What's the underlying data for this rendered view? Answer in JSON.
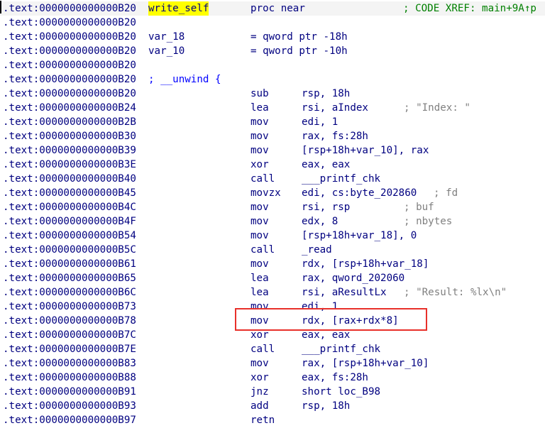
{
  "colors": {
    "address": "#000080",
    "comment": "#808080",
    "xref": "#008000",
    "highlight_name": "#ffff00",
    "annotation_box": "#e8302a"
  },
  "header": {
    "address": ".text:0000000000000B20",
    "name": "write_self",
    "proc": "proc near",
    "xref": "; CODE XREF: main+9A↑p"
  },
  "rows": [
    {
      "addr": ".text:0000000000000B20"
    },
    {
      "addr": ".text:0000000000000B20",
      "name": "var_18",
      "def": "= qword ptr -18h"
    },
    {
      "addr": ".text:0000000000000B20",
      "name": "var_10",
      "def": "= qword ptr -10h"
    },
    {
      "addr": ".text:0000000000000B20"
    },
    {
      "addr": ".text:0000000000000B20",
      "unwind": "; __unwind {"
    },
    {
      "addr": ".text:0000000000000B20",
      "mn": "sub",
      "op": "rsp, 18h"
    },
    {
      "addr": ".text:0000000000000B24",
      "mn": "lea",
      "op": "rsi, aIndex",
      "cm": "; \"Index: \"",
      "cmx": 569
    },
    {
      "addr": ".text:0000000000000B2B",
      "mn": "mov",
      "op": "edi, 1"
    },
    {
      "addr": ".text:0000000000000B30",
      "mn": "mov",
      "op": "rax, fs:28h"
    },
    {
      "addr": ".text:0000000000000B39",
      "mn": "mov",
      "op": "[rsp+18h+var_10], rax"
    },
    {
      "addr": ".text:0000000000000B3E",
      "mn": "xor",
      "op": "eax, eax"
    },
    {
      "addr": ".text:0000000000000B40",
      "mn": "call",
      "op": "___printf_chk"
    },
    {
      "addr": ".text:0000000000000B45",
      "mn": "movzx",
      "op": "edi, cs:byte_202860",
      "cm": "; fd",
      "cmx": 611
    },
    {
      "addr": ".text:0000000000000B4C",
      "mn": "mov",
      "op": "rsi, rsp",
      "cm": "; buf",
      "cmx": 569
    },
    {
      "addr": ".text:0000000000000B4F",
      "mn": "mov",
      "op": "edx, 8",
      "cm": "; nbytes",
      "cmx": 569
    },
    {
      "addr": ".text:0000000000000B54",
      "mn": "mov",
      "op": "[rsp+18h+var_18], 0"
    },
    {
      "addr": ".text:0000000000000B5C",
      "mn": "call",
      "op": "_read"
    },
    {
      "addr": ".text:0000000000000B61",
      "mn": "mov",
      "op": "rdx, [rsp+18h+var_18]"
    },
    {
      "addr": ".text:0000000000000B65",
      "mn": "lea",
      "op": "rax, qword_202060"
    },
    {
      "addr": ".text:0000000000000B6C",
      "mn": "lea",
      "op": "rsi, aResultLx",
      "cm": "; \"Result: %lx\\n\"",
      "cmx": 569
    },
    {
      "addr": ".text:0000000000000B73",
      "mn": "mov",
      "op": "edi, 1"
    },
    {
      "addr": ".text:0000000000000B78",
      "mn": "mov",
      "op": "rdx, [rax+rdx*8]"
    },
    {
      "addr": ".text:0000000000000B7C",
      "mn": "xor",
      "op": "eax, eax"
    },
    {
      "addr": ".text:0000000000000B7E",
      "mn": "call",
      "op": "___printf_chk"
    },
    {
      "addr": ".text:0000000000000B83",
      "mn": "mov",
      "op": "rax, [rsp+18h+var_10]"
    },
    {
      "addr": ".text:0000000000000B88",
      "mn": "xor",
      "op": "eax, fs:28h"
    },
    {
      "addr": ".text:0000000000000B91",
      "mn": "jnz",
      "op": "short loc_B98"
    },
    {
      "addr": ".text:0000000000000B93",
      "mn": "add",
      "op": "rsp, 18h"
    },
    {
      "addr": ".text:0000000000000B97",
      "mn": "retn"
    }
  ]
}
